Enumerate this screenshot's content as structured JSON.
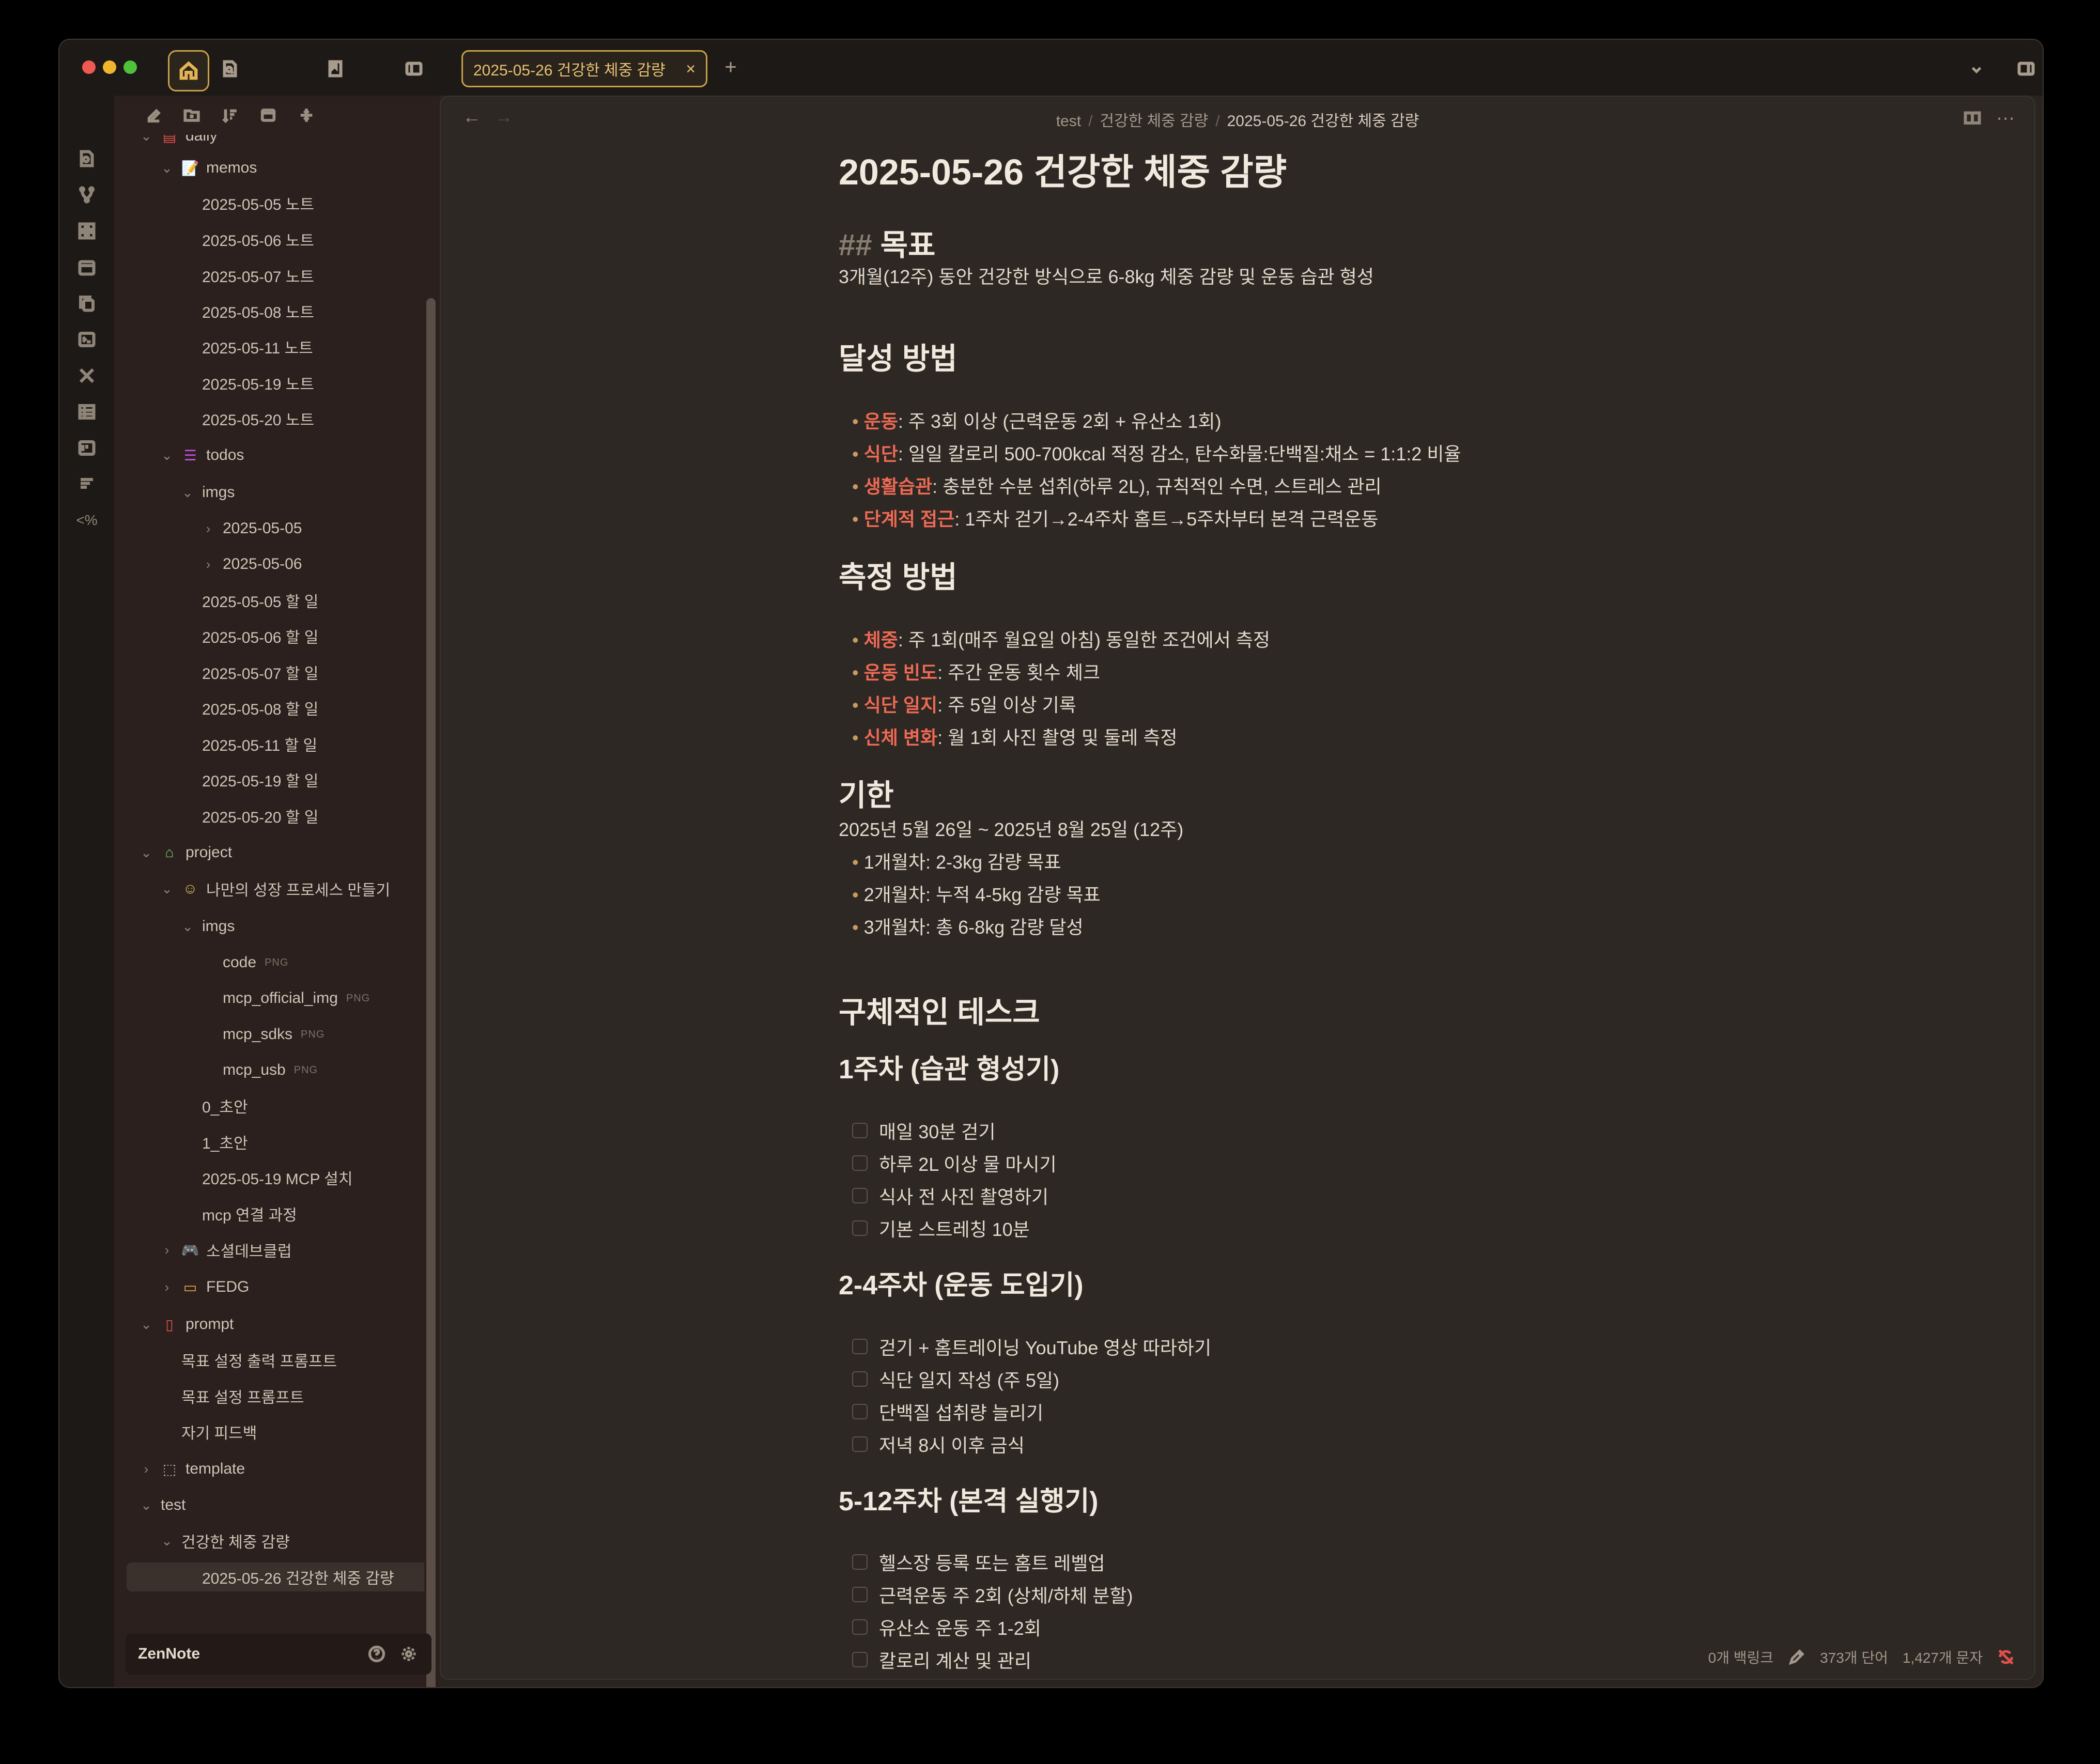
{
  "tab": {
    "title": "2025-05-26 건강한 체중 감량",
    "close": "×",
    "new": "+"
  },
  "breadcrumb": {
    "root": "test",
    "folder": "건강한 체중 감량",
    "current": "2025-05-26 건강한 체중 감량"
  },
  "nav": {
    "back": "←",
    "forward": "→"
  },
  "tree": [
    {
      "label": "daily",
      "chev": "⌄",
      "icon": "▤",
      "icon_name": "calendar-icon",
      "color": "#e0504a"
    },
    {
      "label": "memos",
      "chev": "⌄",
      "icon": "📝",
      "icon_name": "memo-icon",
      "color": "#d8c07a"
    },
    {
      "label": "2025-05-05 노트"
    },
    {
      "label": "2025-05-06 노트"
    },
    {
      "label": "2025-05-07 노트"
    },
    {
      "label": "2025-05-08 노트"
    },
    {
      "label": "2025-05-11 노트"
    },
    {
      "label": "2025-05-19 노트"
    },
    {
      "label": "2025-05-20 노트"
    },
    {
      "label": "todos",
      "chev": "⌄",
      "icon": "☰",
      "icon_name": "checklist-icon",
      "color": "#c050e0"
    },
    {
      "label": "imgs",
      "chev": "⌄"
    },
    {
      "label": "2025-05-05",
      "chev": "›"
    },
    {
      "label": "2025-05-06",
      "chev": "›"
    },
    {
      "label": "2025-05-05 할 일"
    },
    {
      "label": "2025-05-06 할 일"
    },
    {
      "label": "2025-05-07 할 일"
    },
    {
      "label": "2025-05-08 할 일"
    },
    {
      "label": "2025-05-11 할 일"
    },
    {
      "label": "2025-05-19 할 일"
    },
    {
      "label": "2025-05-20 할 일"
    },
    {
      "label": "project",
      "chev": "⌄",
      "icon": "⌂",
      "icon_name": "robot-icon",
      "color": "#7fd07a"
    },
    {
      "label": "나만의 성장 프로세스 만들기",
      "chev": "⌄",
      "icon": "☺",
      "icon_name": "smile-icon",
      "color": "#e6c35a"
    },
    {
      "label": "imgs",
      "chev": "⌄"
    },
    {
      "label": "code",
      "badge": "PNG"
    },
    {
      "label": "mcp_official_img",
      "badge": "PNG"
    },
    {
      "label": "mcp_sdks",
      "badge": "PNG"
    },
    {
      "label": "mcp_usb",
      "badge": "PNG"
    },
    {
      "label": "0_초안"
    },
    {
      "label": "1_초안"
    },
    {
      "label": "2025-05-19 MCP 설치"
    },
    {
      "label": "mcp 연결 과정"
    },
    {
      "label": "소셜데브클럽",
      "chev": "›",
      "icon": "🎮",
      "icon_name": "gamepad-icon",
      "color": "#6fd6e0"
    },
    {
      "label": "FEDG",
      "chev": "›",
      "icon": "▭",
      "icon_name": "monitor-icon",
      "color": "#e8a84a"
    },
    {
      "label": "prompt",
      "chev": "⌄",
      "icon": "▯",
      "icon_name": "notebook-icon",
      "color": "#e0504a"
    },
    {
      "label": "목표 설정 출력 프롬프트"
    },
    {
      "label": "목표 설정 프롬프트"
    },
    {
      "label": "자기 피드백"
    },
    {
      "label": "template",
      "chev": "›",
      "icon": "⬚",
      "icon_name": "template-icon",
      "color": "#b8aea2"
    },
    {
      "label": "test",
      "chev": "⌄"
    },
    {
      "label": "건강한 체중 감량",
      "chev": "⌄"
    },
    {
      "label": "2025-05-26 건강한 체중 감량",
      "active": true
    }
  ],
  "vault": {
    "name": "ZenNote"
  },
  "doc": {
    "title": "2025-05-26 건강한 체중 감량",
    "goal": {
      "hash": "##",
      "heading": "목표",
      "text": "3개월(12주) 동안 건강한 방식으로 6-8kg 체중 감량 및 운동 습관 형성"
    },
    "method": {
      "heading": "달성 방법",
      "items": [
        {
          "key": "운동",
          "text": ": 주 3회 이상 (근력운동 2회 + 유산소 1회)"
        },
        {
          "key": "식단",
          "text": ": 일일 칼로리 500-700kcal 적정 감소, 탄수화물:단백질:채소 = 1:1:2 비율"
        },
        {
          "key": "생활습관",
          "text": ": 충분한 수분 섭취(하루 2L), 규칙적인 수면, 스트레스 관리"
        },
        {
          "key": "단계적 접근",
          "text": ": 1주차 걷기→2-4주차 홈트→5주차부터 본격 근력운동"
        }
      ]
    },
    "measure": {
      "heading": "측정 방법",
      "items": [
        {
          "key": "체중",
          "text": ": 주 1회(매주 월요일 아침) 동일한 조건에서 측정"
        },
        {
          "key": "운동 빈도",
          "text": ": 주간 운동 횟수 체크"
        },
        {
          "key": "식단 일지",
          "text": ": 주 5일 이상 기록"
        },
        {
          "key": "신체 변화",
          "text": ": 월 1회 사진 촬영 및 둘레 측정"
        }
      ]
    },
    "deadline": {
      "heading": "기한",
      "text": "2025년 5월 26일 ~ 2025년 8월 25일 (12주)",
      "items": [
        "1개월차: 2-3kg 감량 목표",
        "2개월차: 누적 4-5kg 감량 목표",
        "3개월차: 총 6-8kg 감량 달성"
      ]
    },
    "tasks_heading": "구체적인 테스크",
    "week1": {
      "heading": "1주차 (습관 형성기)",
      "items": [
        "매일 30분 걷기",
        "하루 2L 이상 물 마시기",
        "식사 전 사진 촬영하기",
        "기본 스트레칭 10분"
      ]
    },
    "week2": {
      "heading": "2-4주차 (운동 도입기)",
      "items": [
        "걷기 + 홈트레이닝 YouTube 영상 따라하기",
        "식단 일지 작성 (주 5일)",
        "단백질 섭취량 늘리기",
        "저녁 8시 이후 금식"
      ]
    },
    "week5": {
      "heading": "5-12주차 (본격 실행기)",
      "items": [
        "헬스장 등록 또는 홈트 레벨업",
        "근력운동 주 2회 (상체/하체 분할)",
        "유산소 운동 주 1-2회",
        "칼로리 계산 및 관리"
      ]
    }
  },
  "status": {
    "backlinks": "0개 백링크",
    "words": "373개 단어",
    "chars": "1,427개 문자"
  }
}
